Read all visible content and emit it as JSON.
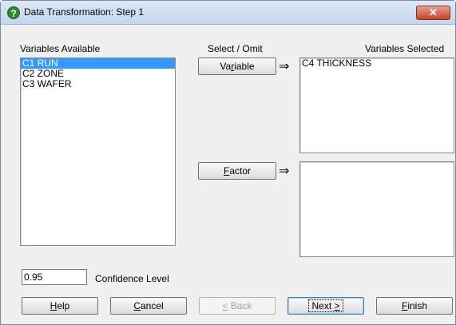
{
  "window": {
    "title": "Data Transformation: Step 1",
    "close_glyph": "✕"
  },
  "left": {
    "heading": "Variables Available",
    "items": [
      "C1 RUN",
      "C2 ZONE",
      "C3 WAFER"
    ],
    "selected_index": 0
  },
  "middle": {
    "heading": "Select / Omit",
    "variable_button": {
      "pre": "Va",
      "accel": "r",
      "post": "iable"
    },
    "factor_button": {
      "pre": "",
      "accel": "F",
      "post": "actor"
    },
    "arrow": "⇒"
  },
  "right": {
    "heading": "Variables Selected",
    "variable_items": [
      "C4 THICKNESS"
    ],
    "factor_items": []
  },
  "confidence": {
    "value": "0.95",
    "label": "Confidence Level"
  },
  "buttons": {
    "help": {
      "pre": "",
      "accel": "H",
      "post": "elp"
    },
    "cancel": {
      "pre": "",
      "accel": "C",
      "post": "ancel"
    },
    "back": {
      "pre": "",
      "accel": "<",
      "post": " Back"
    },
    "next": {
      "pre": "Next ",
      "accel": ">",
      "post": ""
    },
    "finish": {
      "pre": "",
      "accel": "F",
      "post": "inish"
    }
  }
}
